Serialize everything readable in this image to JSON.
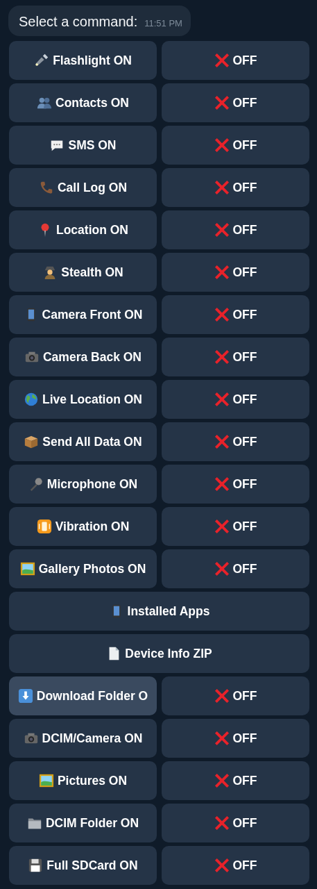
{
  "message": {
    "text": "Select a command:",
    "time": "11:51 PM"
  },
  "keyboard": [
    {
      "buttons": [
        {
          "label": "Flashlight ON",
          "kind": "on",
          "highlighted": false
        },
        {
          "label": "OFF",
          "kind": "off",
          "highlighted": false
        }
      ]
    },
    {
      "buttons": [
        {
          "label": "Contacts ON",
          "kind": "on",
          "highlighted": false
        },
        {
          "label": "OFF",
          "kind": "off",
          "highlighted": false
        }
      ]
    },
    {
      "buttons": [
        {
          "label": "SMS ON",
          "kind": "on",
          "highlighted": false
        },
        {
          "label": "OFF",
          "kind": "off",
          "highlighted": false
        }
      ]
    },
    {
      "buttons": [
        {
          "label": "Call Log ON",
          "kind": "on",
          "highlighted": false
        },
        {
          "label": "OFF",
          "kind": "off",
          "highlighted": false
        }
      ]
    },
    {
      "buttons": [
        {
          "label": "Location ON",
          "kind": "on",
          "highlighted": false
        },
        {
          "label": "OFF",
          "kind": "off",
          "highlighted": false
        }
      ]
    },
    {
      "buttons": [
        {
          "label": "Stealth ON",
          "kind": "on",
          "highlighted": false
        },
        {
          "label": "OFF",
          "kind": "off",
          "highlighted": false
        }
      ]
    },
    {
      "buttons": [
        {
          "label": "Camera Front ON",
          "kind": "on",
          "highlighted": false
        },
        {
          "label": "OFF",
          "kind": "off",
          "highlighted": false
        }
      ]
    },
    {
      "buttons": [
        {
          "label": "Camera Back ON",
          "kind": "on",
          "highlighted": false
        },
        {
          "label": "OFF",
          "kind": "off",
          "highlighted": false
        }
      ]
    },
    {
      "buttons": [
        {
          "label": "Live Location ON",
          "kind": "on",
          "highlighted": false
        },
        {
          "label": "OFF",
          "kind": "off",
          "highlighted": false
        }
      ]
    },
    {
      "buttons": [
        {
          "label": "Send All Data ON",
          "kind": "on",
          "highlighted": false
        },
        {
          "label": "OFF",
          "kind": "off",
          "highlighted": false
        }
      ]
    },
    {
      "buttons": [
        {
          "label": "Microphone ON",
          "kind": "on",
          "highlighted": false
        },
        {
          "label": "OFF",
          "kind": "off",
          "highlighted": false
        }
      ]
    },
    {
      "buttons": [
        {
          "label": "Vibration ON",
          "kind": "on",
          "highlighted": false
        },
        {
          "label": "OFF",
          "kind": "off",
          "highlighted": false
        }
      ]
    },
    {
      "buttons": [
        {
          "label": "Gallery Photos ON",
          "kind": "on",
          "highlighted": false
        },
        {
          "label": "OFF",
          "kind": "off",
          "highlighted": false
        }
      ]
    },
    {
      "buttons": [
        {
          "label": "Installed Apps",
          "kind": "action",
          "highlighted": false
        }
      ]
    },
    {
      "buttons": [
        {
          "label": "Device Info ZIP",
          "kind": "action",
          "highlighted": false
        }
      ]
    },
    {
      "buttons": [
        {
          "label": "Download Folder O",
          "kind": "on",
          "highlighted": true
        },
        {
          "label": "OFF",
          "kind": "off",
          "highlighted": false
        }
      ]
    },
    {
      "buttons": [
        {
          "label": "DCIM/Camera ON",
          "kind": "on",
          "highlighted": false
        },
        {
          "label": "OFF",
          "kind": "off",
          "highlighted": false
        }
      ]
    },
    {
      "buttons": [
        {
          "label": "Pictures ON",
          "kind": "on",
          "highlighted": false
        },
        {
          "label": "OFF",
          "kind": "off",
          "highlighted": false
        }
      ]
    },
    {
      "buttons": [
        {
          "label": "DCIM Folder ON",
          "kind": "on",
          "highlighted": false
        },
        {
          "label": "OFF",
          "kind": "off",
          "highlighted": false
        }
      ]
    },
    {
      "buttons": [
        {
          "label": "Full SDCard ON",
          "kind": "on",
          "highlighted": false
        },
        {
          "label": "OFF",
          "kind": "off",
          "highlighted": false
        }
      ]
    }
  ]
}
